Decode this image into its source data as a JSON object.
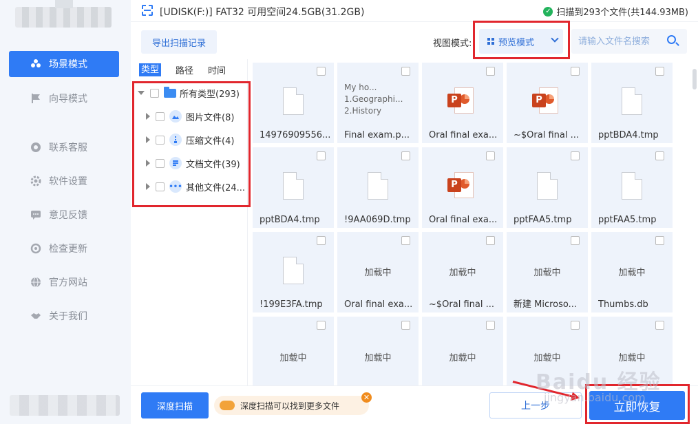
{
  "sidebar": {
    "items": [
      {
        "label": "场景模式",
        "icon": "people-icon",
        "active": true
      },
      {
        "label": "向导模式",
        "icon": "flag-icon",
        "active": false
      },
      {
        "label": "联系客服",
        "icon": "headset-icon",
        "active": false
      },
      {
        "label": "软件设置",
        "icon": "gear-icon",
        "active": false
      },
      {
        "label": "意见反馈",
        "icon": "chat-icon",
        "active": false
      },
      {
        "label": "检查更新",
        "icon": "refresh-icon",
        "active": false
      },
      {
        "label": "官方网站",
        "icon": "globe-icon",
        "active": false
      },
      {
        "label": "关于我们",
        "icon": "handshake-icon",
        "active": false
      }
    ]
  },
  "header": {
    "drive": "[UDISK(F:)] FAT32 可用空间24.5GB(31.2GB)",
    "status": "扫描到293个文件(共144.93MB)"
  },
  "toolbar": {
    "export_label": "导出扫描记录",
    "view_label": "视图模式:",
    "view_selected": "预览模式",
    "search_placeholder": "请输入文件名搜索"
  },
  "tree": {
    "tabs": [
      "类型",
      "路径",
      "时间"
    ],
    "root": "所有类型(293)",
    "categories": [
      {
        "label": "图片文件(8)",
        "icon": "image-icon"
      },
      {
        "label": "压缩文件(4)",
        "icon": "zip-icon"
      },
      {
        "label": "文档文件(39)",
        "icon": "document-icon"
      },
      {
        "label": "其他文件(24...",
        "icon": "more-icon"
      }
    ]
  },
  "files": [
    {
      "name": "14976909556...",
      "type": "doc"
    },
    {
      "name": "Final exam.p...",
      "type": "text",
      "preview": "My ho...\n1.Geographi...\n2.History"
    },
    {
      "name": "Oral final exa...",
      "type": "ppt"
    },
    {
      "name": "~$Oral final ...",
      "type": "ppt"
    },
    {
      "name": "pptBDA4.tmp",
      "type": "doc"
    },
    {
      "name": "pptBDA4.tmp",
      "type": "doc"
    },
    {
      "name": "!9AA069D.tmp",
      "type": "doc"
    },
    {
      "name": "Oral final exa...",
      "type": "ppt"
    },
    {
      "name": "pptFAA5.tmp",
      "type": "doc"
    },
    {
      "name": "pptFAA5.tmp",
      "type": "doc"
    },
    {
      "name": "!199E3FA.tmp",
      "type": "doc"
    },
    {
      "name": "Oral final exa...",
      "type": "loading"
    },
    {
      "name": "~$Oral final ...",
      "type": "loading"
    },
    {
      "name": "新建 Microso...",
      "type": "loading"
    },
    {
      "name": "Thumbs.db",
      "type": "loading"
    },
    {
      "name": "",
      "type": "loading"
    },
    {
      "name": "",
      "type": "loading"
    },
    {
      "name": "",
      "type": "loading"
    },
    {
      "name": "",
      "type": "loading"
    },
    {
      "name": "",
      "type": "loading"
    }
  ],
  "loading_text": "加载中",
  "footer": {
    "deep_scan": "深度扫描",
    "tip": "深度扫描可以找到更多文件",
    "prev": "上一步",
    "recover": "立即恢复"
  },
  "watermark": {
    "main": "Baidu 经验",
    "sub": "jingyan.baidu.com"
  },
  "colors": {
    "accent": "#2f7bf5",
    "highlight": "#e1262d"
  }
}
